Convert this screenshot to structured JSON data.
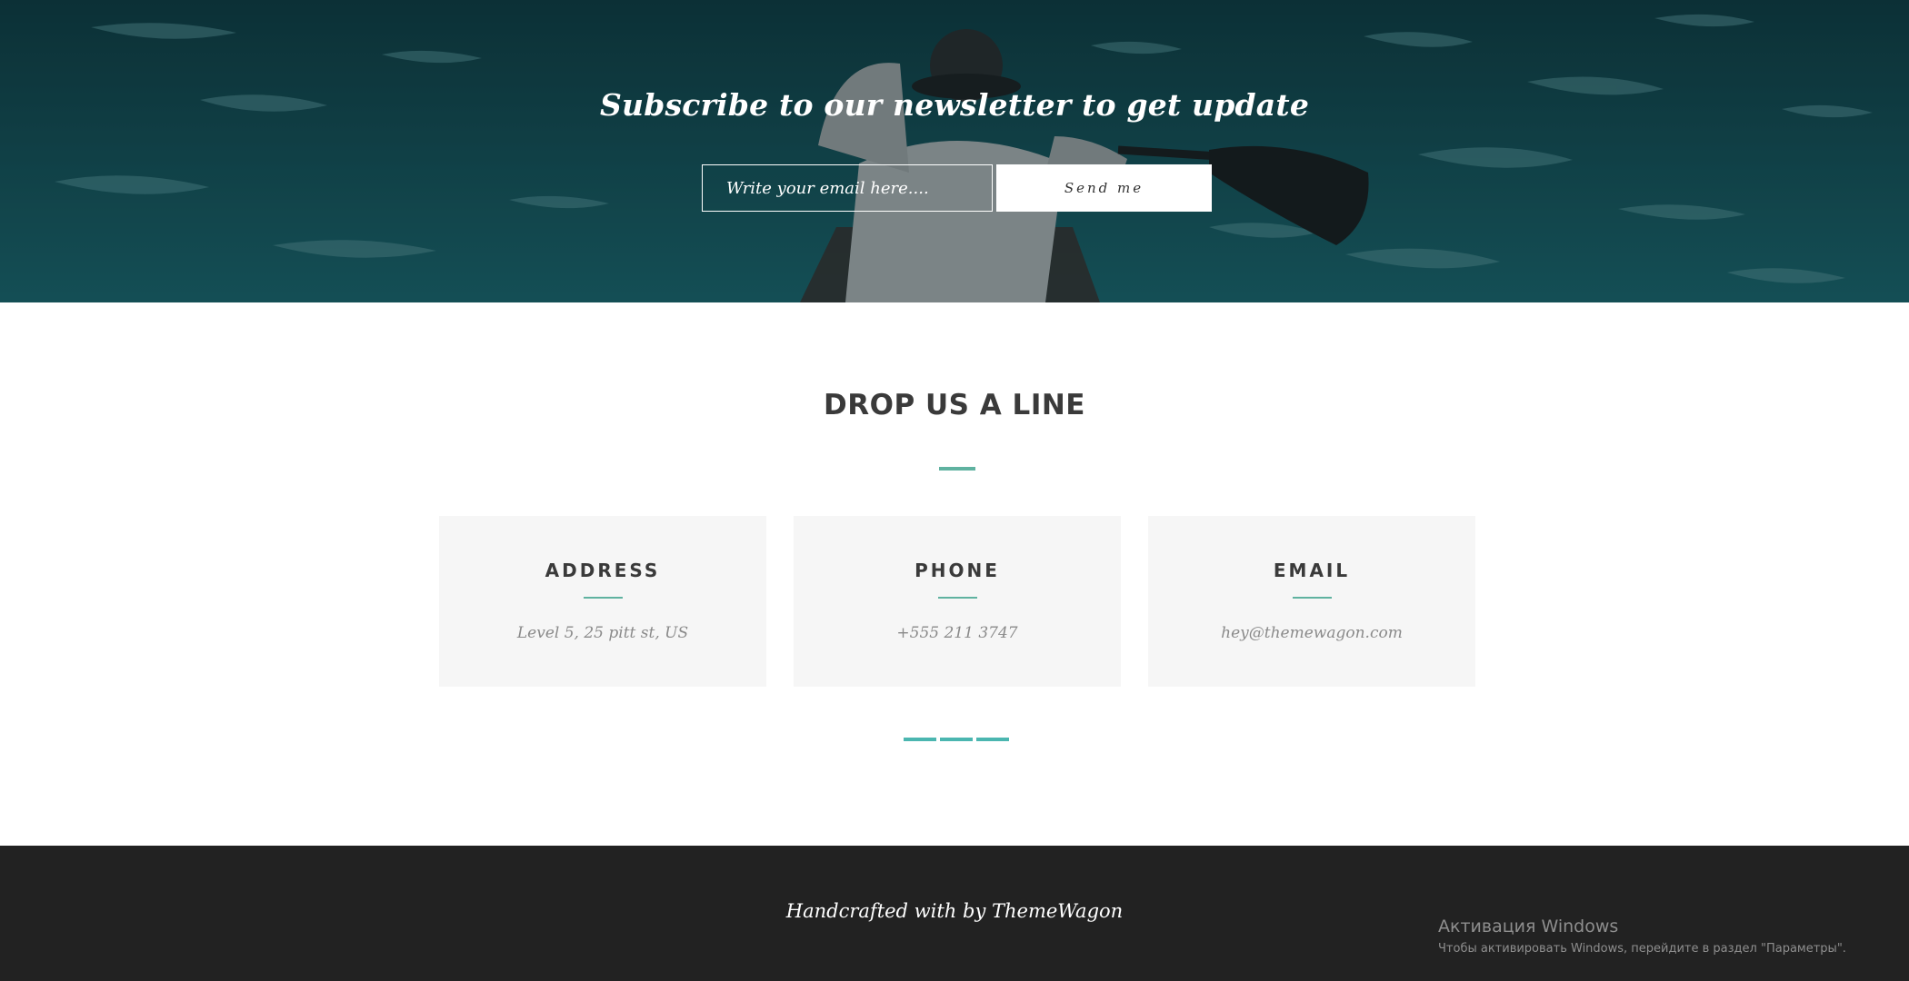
{
  "newsletter": {
    "title": "Subscribe to our newsletter to get update",
    "email_placeholder": "Write your email here....",
    "send_label": "Send me"
  },
  "contact": {
    "title": "DROP US A LINE",
    "cards": [
      {
        "title": "ADDRESS",
        "value": "Level 5, 25 pitt st, US"
      },
      {
        "title": "PHONE",
        "value": "+555 211 3747"
      },
      {
        "title": "EMAIL",
        "value": "hey@themewagon.com"
      }
    ],
    "pagination_count": 3
  },
  "footer": {
    "credit": "Handcrafted with by ThemeWagon"
  },
  "windows_activation": {
    "title": "Активация Windows",
    "subtitle": "Чтобы активировать Windows, перейдите в раздел \"Параметры\"."
  },
  "colors": {
    "accent": "#5fb2a0",
    "pagination": "#4bb6b0",
    "footer_bg": "#222222",
    "card_bg": "#f6f6f6"
  }
}
